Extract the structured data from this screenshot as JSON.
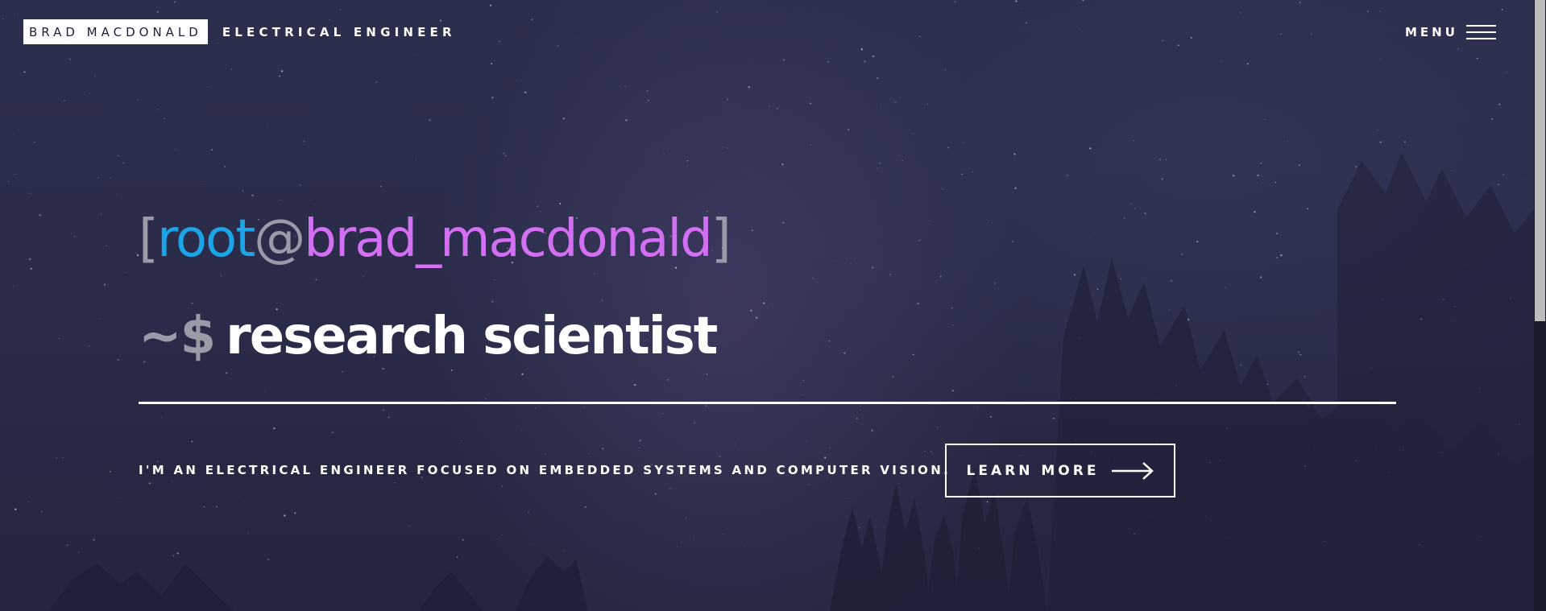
{
  "header": {
    "brand_name": "BRAD MACDONALD",
    "brand_subtitle": "ELECTRICAL ENGINEER",
    "menu_label": "MENU",
    "menu_icon": "hamburger-icon"
  },
  "hero": {
    "prompt": {
      "open_bracket": "[",
      "user": "root",
      "at": "@",
      "host": "brad_macdonald",
      "close_bracket": "]"
    },
    "command": {
      "symbol": "~$",
      "text": "research scientist"
    },
    "tagline": "I'M AN ELECTRICAL ENGINEER FOCUSED ON EMBEDDED SYSTEMS AND COMPUTER VISION.",
    "cta_label": "LEARN MORE",
    "cta_icon": "arrow-right-icon"
  },
  "colors": {
    "background": "#2a2c4a",
    "user": "#1ba5e6",
    "host": "#d36ff2",
    "muted": "#9a9ba8",
    "text": "#ffffff"
  }
}
